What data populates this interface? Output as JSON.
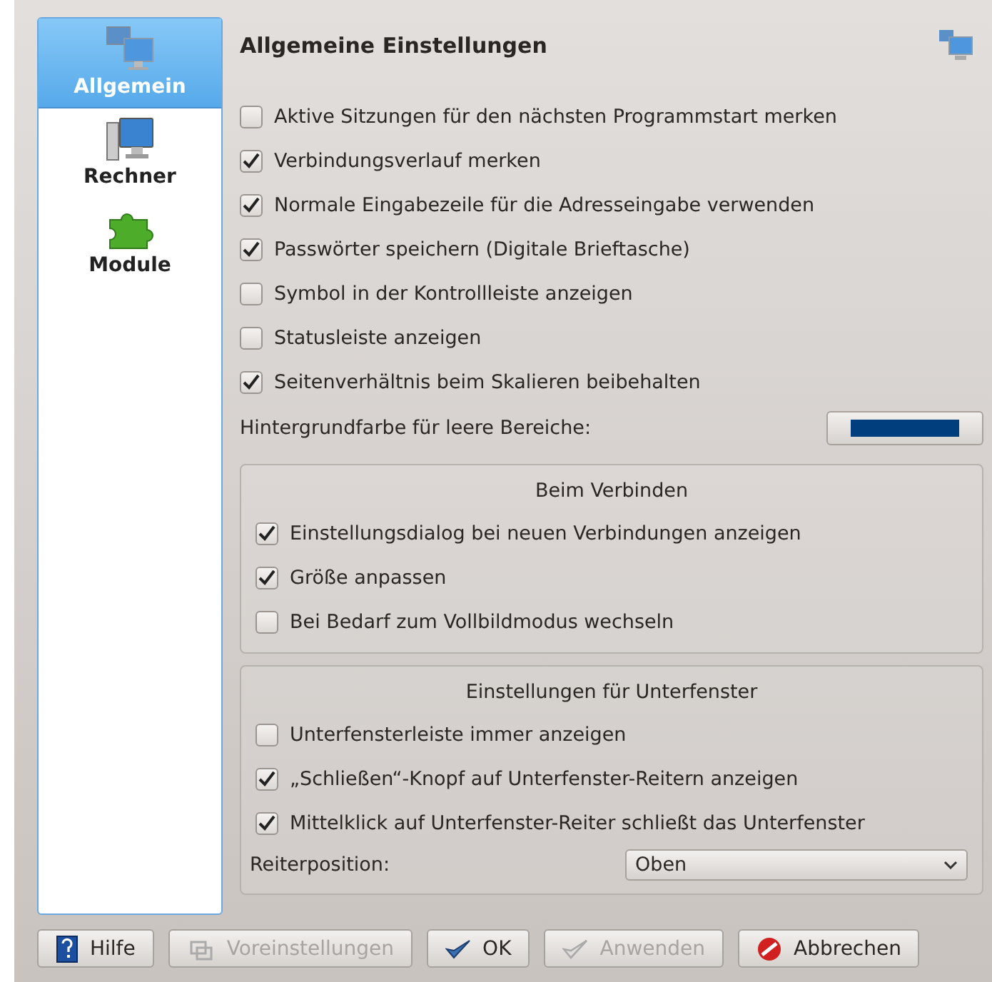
{
  "sidebar": {
    "items": [
      {
        "label": "Allgemein",
        "kind": "network",
        "selected": true
      },
      {
        "label": "Rechner",
        "kind": "computer",
        "selected": false
      },
      {
        "label": "Module",
        "kind": "puzzle",
        "selected": false
      }
    ]
  },
  "page": {
    "title": "Allgemeine Einstellungen",
    "options": [
      {
        "label": "Aktive Sitzungen für den nächsten Programmstart merken",
        "checked": false
      },
      {
        "label": "Verbindungsverlauf merken",
        "checked": true
      },
      {
        "label": "Normale Eingabezeile für die Adresseingabe verwenden",
        "checked": true
      },
      {
        "label": "Passwörter speichern (Digitale Brieftasche)",
        "checked": true
      },
      {
        "label": "Symbol in der Kontrollleiste anzeigen",
        "checked": false
      },
      {
        "label": "Statusleiste anzeigen",
        "checked": false
      },
      {
        "label": "Seitenverhältnis beim Skalieren beibehalten",
        "checked": true
      }
    ],
    "background_color": {
      "label": "Hintergrundfarbe für leere Bereiche:",
      "color": "#003e7e"
    },
    "groups": [
      {
        "title": "Beim Verbinden",
        "options": [
          {
            "label": "Einstellungsdialog bei neuen Verbindungen anzeigen",
            "checked": true
          },
          {
            "label": "Größe anpassen",
            "checked": true
          },
          {
            "label": "Bei Bedarf zum Vollbildmodus wechseln",
            "checked": false
          }
        ]
      },
      {
        "title": "Einstellungen für Unterfenster",
        "options": [
          {
            "label": "Unterfensterleiste immer anzeigen",
            "checked": false
          },
          {
            "label": "„Schließen“-Knopf auf Unterfenster-Reitern anzeigen",
            "checked": true
          },
          {
            "label": "Mittelklick auf Unterfenster-Reiter schließt das Unterfenster",
            "checked": true
          }
        ],
        "select": {
          "label": "Reiterposition:",
          "value": "Oben"
        }
      }
    ]
  },
  "buttons": [
    {
      "label": "Hilfe",
      "kind": "help",
      "disabled": false
    },
    {
      "label": "Voreinstellungen",
      "kind": "defaults",
      "disabled": true
    },
    {
      "label": "OK",
      "kind": "ok",
      "disabled": false
    },
    {
      "label": "Anwenden",
      "kind": "apply",
      "disabled": true
    },
    {
      "label": "Abbrechen",
      "kind": "cancel",
      "disabled": false
    }
  ]
}
